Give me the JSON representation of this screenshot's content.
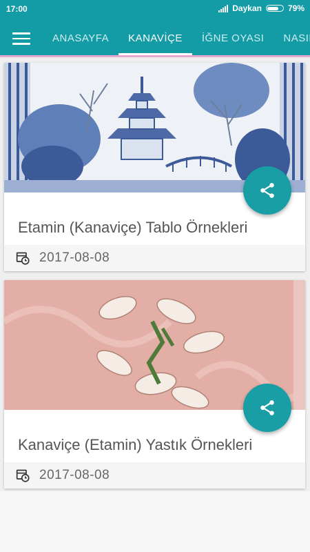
{
  "status": {
    "time": "17:00",
    "carrier": "Daykan",
    "battery_percent": "79%",
    "battery_level": 0.79
  },
  "nav": {
    "tabs": [
      {
        "label": "ANASAYFA",
        "active": false
      },
      {
        "label": "KANAVİÇE",
        "active": true
      },
      {
        "label": "İĞNE OYASI",
        "active": false
      },
      {
        "label": "NASIL",
        "active": false
      }
    ]
  },
  "cards": [
    {
      "title": "Etamin (Kanaviçe) Tablo Örnekleri",
      "date": "2017-08-08",
      "image": "blue-white-pagoda-cross-stitch"
    },
    {
      "title": "Kanaviçe (Etamin) Yastık Örnekleri",
      "date": "2017-08-08",
      "image": "pink-lily-cross-stitch"
    }
  ],
  "colors": {
    "primary": "#139ba6",
    "accent": "#e8a9cf",
    "fab": "#1a9ea6"
  }
}
